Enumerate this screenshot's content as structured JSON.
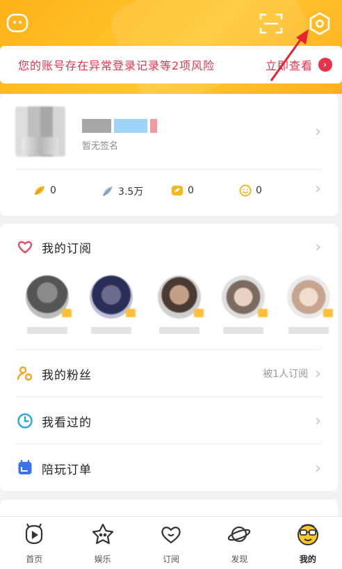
{
  "header": {
    "icons": [
      "message-icon",
      "scan-icon",
      "settings-icon"
    ],
    "background_color": "#ffc02a"
  },
  "risk_banner": {
    "text": "您的账号存在异常登录记录等2项风险",
    "action_label": "立即查看",
    "color": "#e8334a"
  },
  "profile": {
    "signature": "暂无签名"
  },
  "stats": [
    {
      "icon": "leaf-icon",
      "value": "0"
    },
    {
      "icon": "feather-icon",
      "value": "3.5万"
    },
    {
      "icon": "coin-icon",
      "value": "0"
    },
    {
      "icon": "smile-coin-icon",
      "value": "0"
    }
  ],
  "sections": {
    "subscriptions": {
      "label": "我的订阅",
      "icon": "heart-icon"
    },
    "fans": {
      "label": "我的粉丝",
      "icon": "fans-icon",
      "extra": "被1人订阅"
    },
    "history": {
      "label": "我看过的",
      "icon": "clock-icon"
    },
    "orders": {
      "label": "陪玩订单",
      "icon": "order-icon"
    }
  },
  "bottom_nav": [
    {
      "label": "首页",
      "icon": "home-icon",
      "active": false
    },
    {
      "label": "娱乐",
      "icon": "star-icon",
      "active": false
    },
    {
      "label": "订阅",
      "icon": "heart-outline-icon",
      "active": false
    },
    {
      "label": "发现",
      "icon": "planet-icon",
      "active": false
    },
    {
      "label": "我的",
      "icon": "profile-face-icon",
      "active": true
    }
  ]
}
